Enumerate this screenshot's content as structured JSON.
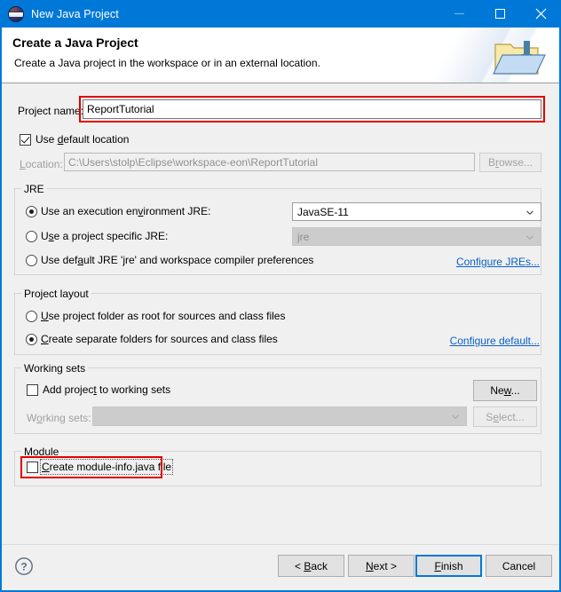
{
  "window": {
    "title": "New Java Project",
    "icon": "eclipse-logo-icon",
    "accent_color": "#0078d7",
    "controls": {
      "minimize": "minimize-icon",
      "maximize": "maximize-icon",
      "close": "close-icon"
    }
  },
  "header": {
    "title": "Create a Java Project",
    "description": "Create a Java project in the workspace or in an external location.",
    "icon": "new-java-project-folder-icon"
  },
  "project_name": {
    "label": "Project name:",
    "value": "ReportTutorial",
    "placeholder": "",
    "highlight_color": "#e10000"
  },
  "location": {
    "use_default_label": "Use default location",
    "use_default_checked": true,
    "label": "Location:",
    "value": "C:\\Users\\stolp\\Eclipse\\workspace-eon\\ReportTutorial",
    "browse_label": "Browse..."
  },
  "jre": {
    "group_title": "JRE",
    "options": [
      {
        "label": "Use an execution environment JRE:",
        "selected": true
      },
      {
        "label": "Use a project specific JRE:",
        "selected": false
      },
      {
        "label": "Use default JRE 'jre' and workspace compiler preferences",
        "selected": false
      }
    ],
    "execution_env_value": "JavaSE-11",
    "project_jre_value": "jre",
    "configure_link": "Configure JREs..."
  },
  "project_layout": {
    "group_title": "Project layout",
    "options": [
      {
        "label": "Use project folder as root for sources and class files",
        "selected": false
      },
      {
        "label": "Create separate folders for sources and class files",
        "selected": true
      }
    ],
    "configure_link": "Configure default..."
  },
  "working_sets": {
    "group_title": "Working sets",
    "add_label": "Add project to working sets",
    "add_checked": false,
    "sets_label": "Working sets:",
    "sets_value": "",
    "new_button": "New...",
    "select_button": "Select..."
  },
  "module": {
    "group_title": "Module",
    "create_label": "Create module-info.java file",
    "create_checked": false,
    "highlight_color": "#e10000"
  },
  "footer": {
    "help_icon": "help-icon",
    "buttons": [
      {
        "label": "< Back",
        "focused": false,
        "disabled": false
      },
      {
        "label": "Next >",
        "focused": false,
        "disabled": false
      },
      {
        "label": "Finish",
        "focused": true,
        "disabled": false
      },
      {
        "label": "Cancel",
        "focused": false,
        "disabled": false
      }
    ]
  }
}
